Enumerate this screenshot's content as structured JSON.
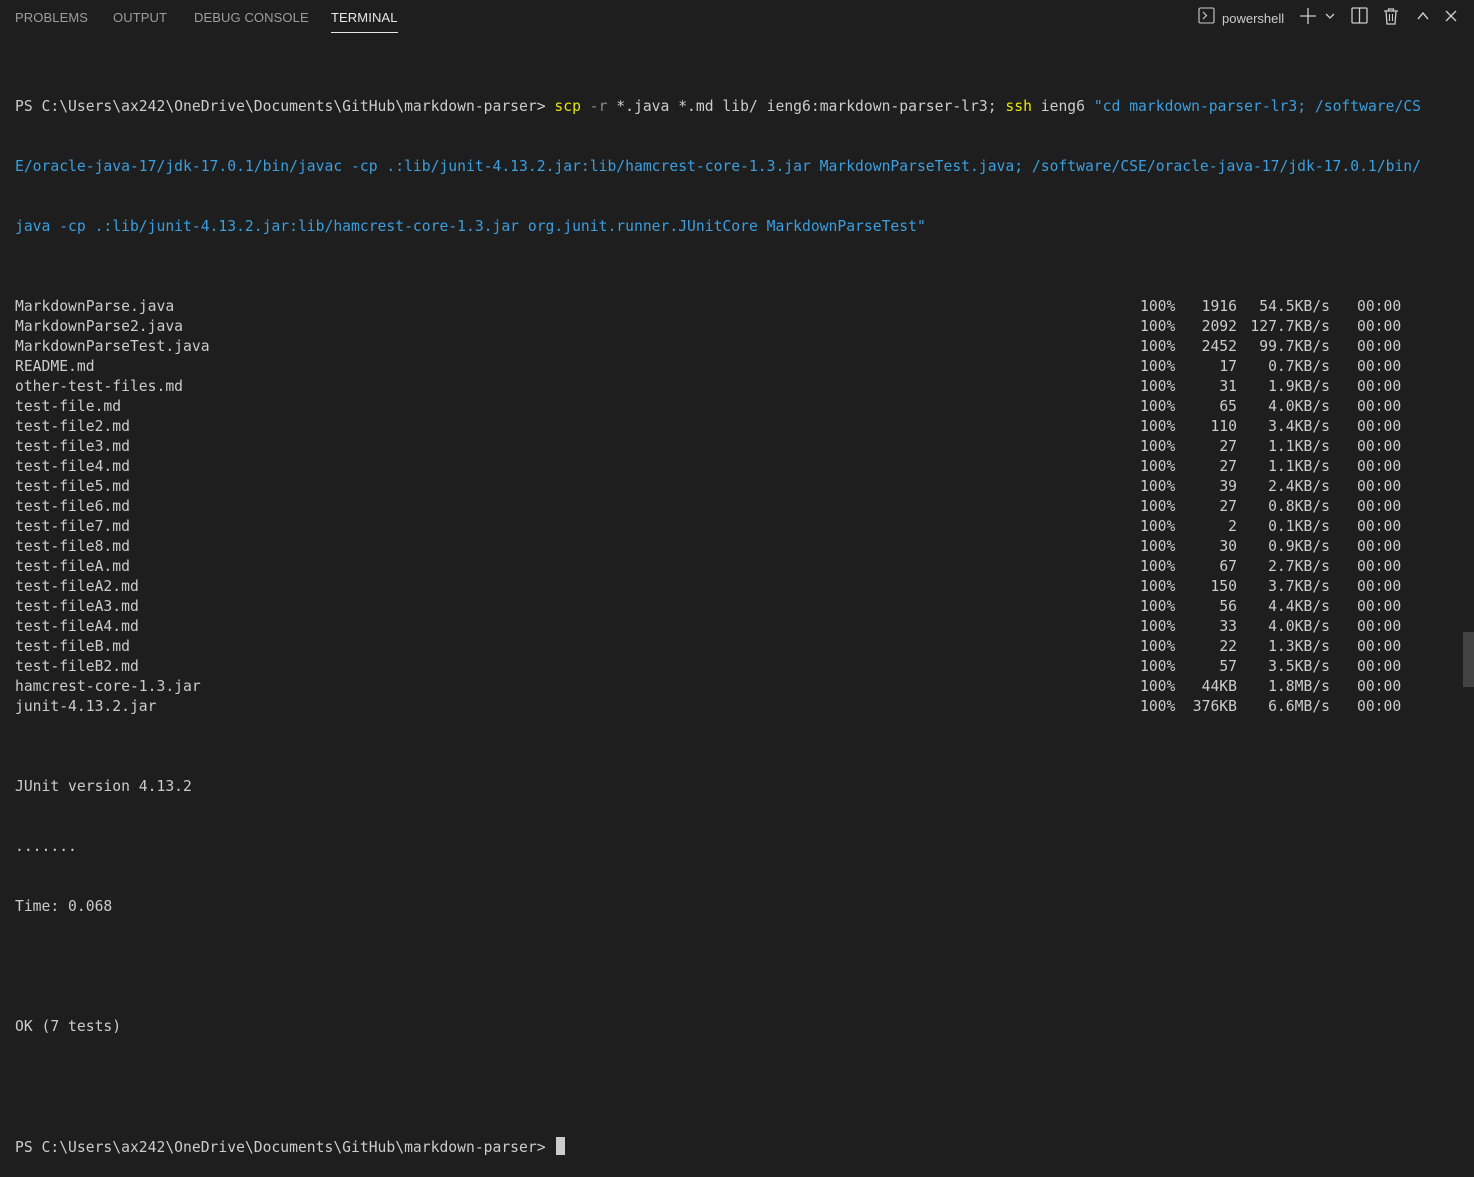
{
  "tabs": [
    {
      "label": "PROBLEMS"
    },
    {
      "label": "OUTPUT"
    },
    {
      "label": "DEBUG CONSOLE"
    },
    {
      "label": "TERMINAL"
    }
  ],
  "shell_selector": {
    "label": "powershell",
    "icon": "terminal-icon"
  },
  "toolbar_icons": [
    "plus-icon",
    "chevron-down-icon",
    "split-icon",
    "trash-icon",
    "chevron-up-icon",
    "close-icon"
  ],
  "command": {
    "prompt": "PS C:\\Users\\ax242\\OneDrive\\Documents\\GitHub\\markdown-parser> ",
    "scp": "scp",
    "flag_r": "-r",
    "scp_args": " *.java *.md lib/ ieng6:markdown-parser-lr3; ",
    "ssh": "ssh",
    "ssh_host": " ieng6 ",
    "quoted_1": "\"cd markdown-parser-lr3; /software/CS",
    "quoted_2": "E/oracle-java-17/jdk-17.0.1/bin/javac -cp .:lib/junit-4.13.2.jar:lib/hamcrest-core-1.3.jar MarkdownParseTest.java; /software/CSE/oracle-java-17/jdk-17.0.1/bin/",
    "quoted_3": "java -cp .:lib/junit-4.13.2.jar:lib/hamcrest-core-1.3.jar org.junit.runner.JUnitCore MarkdownParseTest\""
  },
  "transfers": [
    {
      "file": "MarkdownParse.java",
      "pct": "100%",
      "size": "1916",
      "rate": "54.5KB/s",
      "eta": "00:00"
    },
    {
      "file": "MarkdownParse2.java",
      "pct": "100%",
      "size": "2092",
      "rate": "127.7KB/s",
      "eta": "00:00"
    },
    {
      "file": "MarkdownParseTest.java",
      "pct": "100%",
      "size": "2452",
      "rate": "99.7KB/s",
      "eta": "00:00"
    },
    {
      "file": "README.md",
      "pct": "100%",
      "size": "17",
      "rate": "0.7KB/s",
      "eta": "00:00"
    },
    {
      "file": "other-test-files.md",
      "pct": "100%",
      "size": "31",
      "rate": "1.9KB/s",
      "eta": "00:00"
    },
    {
      "file": "test-file.md",
      "pct": "100%",
      "size": "65",
      "rate": "4.0KB/s",
      "eta": "00:00"
    },
    {
      "file": "test-file2.md",
      "pct": "100%",
      "size": "110",
      "rate": "3.4KB/s",
      "eta": "00:00"
    },
    {
      "file": "test-file3.md",
      "pct": "100%",
      "size": "27",
      "rate": "1.1KB/s",
      "eta": "00:00"
    },
    {
      "file": "test-file4.md",
      "pct": "100%",
      "size": "27",
      "rate": "1.1KB/s",
      "eta": "00:00"
    },
    {
      "file": "test-file5.md",
      "pct": "100%",
      "size": "39",
      "rate": "2.4KB/s",
      "eta": "00:00"
    },
    {
      "file": "test-file6.md",
      "pct": "100%",
      "size": "27",
      "rate": "0.8KB/s",
      "eta": "00:00"
    },
    {
      "file": "test-file7.md",
      "pct": "100%",
      "size": "2",
      "rate": "0.1KB/s",
      "eta": "00:00"
    },
    {
      "file": "test-file8.md",
      "pct": "100%",
      "size": "30",
      "rate": "0.9KB/s",
      "eta": "00:00"
    },
    {
      "file": "test-fileA.md",
      "pct": "100%",
      "size": "67",
      "rate": "2.7KB/s",
      "eta": "00:00"
    },
    {
      "file": "test-fileA2.md",
      "pct": "100%",
      "size": "150",
      "rate": "3.7KB/s",
      "eta": "00:00"
    },
    {
      "file": "test-fileA3.md",
      "pct": "100%",
      "size": "56",
      "rate": "4.4KB/s",
      "eta": "00:00"
    },
    {
      "file": "test-fileA4.md",
      "pct": "100%",
      "size": "33",
      "rate": "4.0KB/s",
      "eta": "00:00"
    },
    {
      "file": "test-fileB.md",
      "pct": "100%",
      "size": "22",
      "rate": "1.3KB/s",
      "eta": "00:00"
    },
    {
      "file": "test-fileB2.md",
      "pct": "100%",
      "size": "57",
      "rate": "3.5KB/s",
      "eta": "00:00"
    },
    {
      "file": "hamcrest-core-1.3.jar",
      "pct": "100%",
      "size": "44KB",
      "rate": "1.8MB/s",
      "eta": "00:00"
    },
    {
      "file": "junit-4.13.2.jar",
      "pct": "100%",
      "size": "376KB",
      "rate": "6.6MB/s",
      "eta": "00:00"
    }
  ],
  "output": {
    "junit_version": "JUnit version 4.13.2",
    "dots": ".......",
    "time": "Time: 0.068",
    "result": "OK (7 tests)"
  },
  "final_prompt": "PS C:\\Users\\ax242\\OneDrive\\Documents\\GitHub\\markdown-parser> "
}
